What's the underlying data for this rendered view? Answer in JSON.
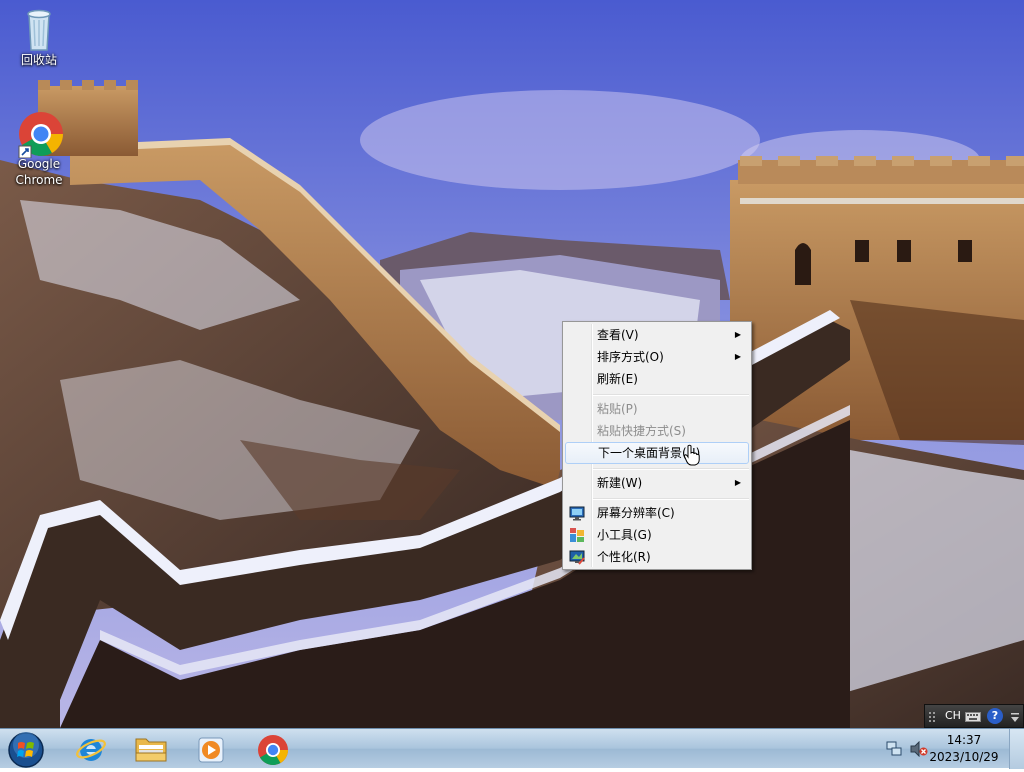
{
  "desktop": {
    "icons": [
      {
        "label": "回收站",
        "icon": "recycle-bin-icon"
      },
      {
        "label": "Google Chrome",
        "icon": "chrome-icon"
      }
    ]
  },
  "context_menu": {
    "items": [
      {
        "label": "查看(V)",
        "submenu": true,
        "disabled": false
      },
      {
        "label": "排序方式(O)",
        "submenu": true,
        "disabled": false
      },
      {
        "label": "刷新(E)",
        "submenu": false,
        "disabled": false
      },
      {
        "label": "粘贴(P)",
        "submenu": false,
        "disabled": true
      },
      {
        "label": "粘贴快捷方式(S)",
        "submenu": false,
        "disabled": true
      },
      {
        "label": "下一个桌面背景(N)",
        "submenu": false,
        "disabled": false,
        "highlighted": true
      },
      {
        "label": "新建(W)",
        "submenu": true,
        "disabled": false
      },
      {
        "label": "屏幕分辨率(C)",
        "submenu": false,
        "disabled": false,
        "icon": "monitor-icon"
      },
      {
        "label": "小工具(G)",
        "submenu": false,
        "disabled": false,
        "icon": "gadgets-icon"
      },
      {
        "label": "个性化(R)",
        "submenu": false,
        "disabled": false,
        "icon": "personalize-icon"
      }
    ],
    "submenu_glyph": "▶"
  },
  "language_bar": {
    "lang": "CH",
    "help": "?"
  },
  "taskbar": {
    "pinned": [
      "start-orb-icon",
      "internet-explorer-icon",
      "file-explorer-icon",
      "media-player-icon",
      "chrome-icon"
    ],
    "clock": {
      "time": "14:37",
      "date": "2023/10/29"
    }
  }
}
